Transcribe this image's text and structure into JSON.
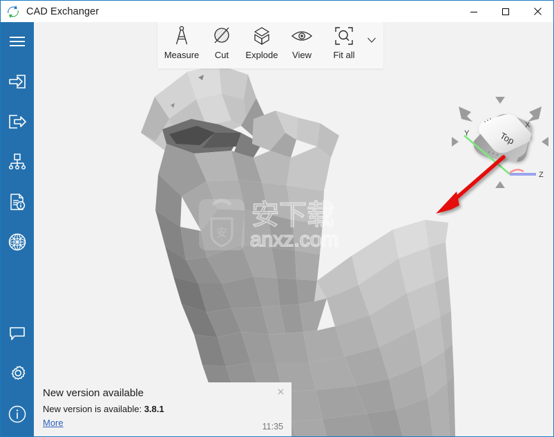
{
  "window": {
    "title": "CAD Exchanger",
    "logo_icon": "exchange-arrows-logo",
    "controls": {
      "minimize": "minimize-icon",
      "maximize": "maximize-icon",
      "close": "close-icon"
    },
    "accent_color": "#1a7bc4"
  },
  "sidebar": {
    "background_color": "#2470ae",
    "top_items": [
      {
        "id": "menu",
        "icon": "hamburger-menu-icon",
        "label": "Menu"
      },
      {
        "id": "import",
        "icon": "import-icon",
        "label": "Import"
      },
      {
        "id": "export",
        "icon": "export-icon",
        "label": "Export"
      },
      {
        "id": "structure",
        "icon": "model-tree-icon",
        "label": "Structure"
      },
      {
        "id": "properties",
        "icon": "document-info-icon",
        "label": "Properties"
      },
      {
        "id": "mesh",
        "icon": "globe-mesh-icon",
        "label": "Mesh"
      }
    ],
    "bottom_items": [
      {
        "id": "feedback",
        "icon": "chat-bubble-icon",
        "label": "Feedback"
      },
      {
        "id": "settings",
        "icon": "gear-icon",
        "label": "Settings"
      },
      {
        "id": "about",
        "icon": "info-circle-icon",
        "label": "About"
      }
    ]
  },
  "toolbar": {
    "background_color": "#f7f7f7",
    "items": [
      {
        "id": "measure",
        "label": "Measure",
        "icon": "caliper-icon"
      },
      {
        "id": "cut",
        "label": "Cut",
        "icon": "section-cut-icon"
      },
      {
        "id": "explode",
        "label": "Explode",
        "icon": "exploded-cube-icon"
      },
      {
        "id": "view",
        "label": "View",
        "icon": "eye-icon"
      },
      {
        "id": "fit-all",
        "label": "Fit all",
        "icon": "fit-all-magnifier-icon"
      }
    ],
    "dropdown_icon": "chevron-down-icon"
  },
  "viewport": {
    "background_color": "#f2f2f2",
    "model_description": "low-poly faceted grayscale mesh",
    "watermark": {
      "text_cn": "安下载",
      "text_latin": "anxz.com",
      "badge_char": "安"
    }
  },
  "viewcube": {
    "face_label": "Top",
    "axis_labels": {
      "x": "X",
      "y": "Y",
      "z": "Z"
    },
    "axis_colors": {
      "x": "#ff4a4a",
      "y": "#7ce77c",
      "z": "#9aa4ee"
    },
    "nav_arrows": [
      "rotate-left-icon",
      "rotate-right-icon",
      "arrow-up-icon",
      "arrow-down-icon",
      "arrow-left-icon",
      "arrow-right-icon"
    ]
  },
  "annotation": {
    "type": "red-arrow",
    "color": "#e51111"
  },
  "notification": {
    "title": "New version available",
    "message_prefix": "New version is available: ",
    "version": "3.8.1",
    "link": "More",
    "time": "11:35",
    "close_icon": "close-icon"
  }
}
